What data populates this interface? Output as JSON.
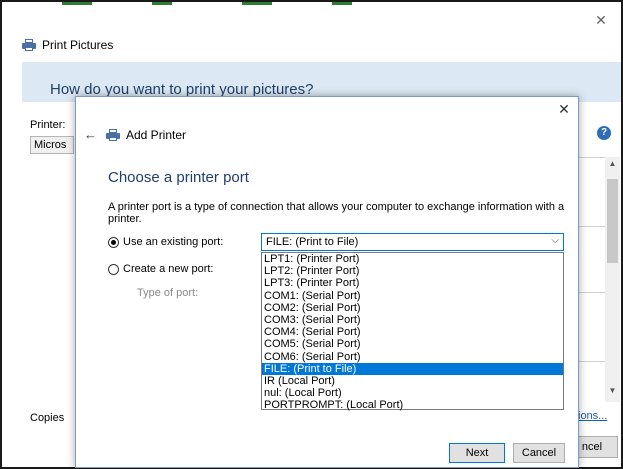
{
  "outer": {
    "title": "Print Pictures",
    "question": "How do you want to print your pictures?",
    "printer_label": "Printer:",
    "printer_value": "Micros",
    "copies_label": "Copies",
    "link_text": "ions...",
    "cancel_label": "ncel",
    "bottom_text": "~~~~~~~~~"
  },
  "dialog": {
    "title": "Add Printer",
    "heading": "Choose a printer port",
    "description": "A printer port is a type of connection that allows your computer to exchange information with a printer.",
    "use_existing_label": "Use an existing port:",
    "create_new_label": "Create a new port:",
    "type_of_port_label": "Type of port:",
    "selected_port": "FILE: (Print to File)",
    "next_label": "Next",
    "cancel_label": "Cancel"
  },
  "ports": [
    "LPT1: (Printer Port)",
    "LPT2: (Printer Port)",
    "LPT3: (Printer Port)",
    "COM1: (Serial Port)",
    "COM2: (Serial Port)",
    "COM3: (Serial Port)",
    "COM4: (Serial Port)",
    "COM5: (Serial Port)",
    "COM6: (Serial Port)",
    "FILE: (Print to File)",
    "IR (Local Port)",
    "nul: (Local Port)",
    "PORTPROMPT: (Local Port)"
  ],
  "selected_index": 9,
  "icons": {
    "close": "close-icon",
    "back": "back-arrow-icon",
    "printer": "printer-icon",
    "help": "help-icon",
    "chevron": "chevron-down-icon"
  },
  "colors": {
    "accent": "#0078d7",
    "banner": "#dce8f3",
    "heading": "#1f3f6b"
  }
}
